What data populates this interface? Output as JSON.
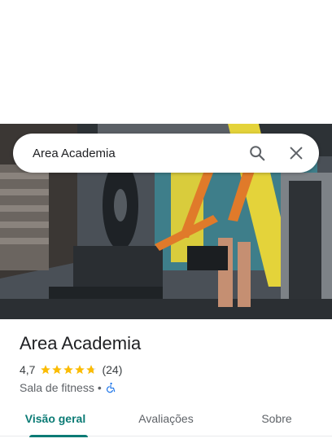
{
  "search": {
    "value": "Area Academia",
    "search_icon": "search-icon",
    "close_icon": "close-icon"
  },
  "place": {
    "name": "Area Academia",
    "rating": "4,7",
    "stars": 4.7,
    "review_count": "(24)",
    "category": "Sala de fitness",
    "separator": "•",
    "accessibility_icon": "wheelchair-icon"
  },
  "tabs": [
    {
      "label": "Visão geral",
      "active": true
    },
    {
      "label": "Avaliações",
      "active": false
    },
    {
      "label": "Sobre",
      "active": false
    }
  ],
  "colors": {
    "accent": "#0b7b75",
    "star": "#fbbc04",
    "accessibility": "#1a73e8"
  }
}
